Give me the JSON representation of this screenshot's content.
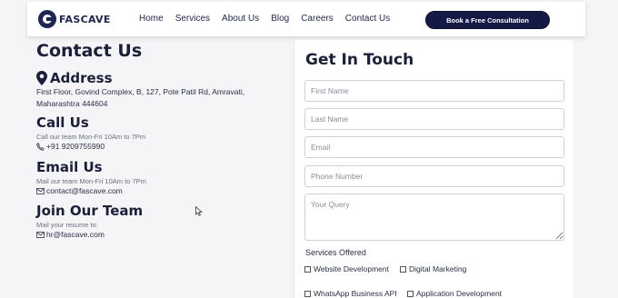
{
  "nav": {
    "logo_text": "FASCAVE",
    "links": [
      "Home",
      "Services",
      "About Us",
      "Blog",
      "Careers",
      "Contact Us"
    ],
    "cta_label": "Book a Free Consultation"
  },
  "contact": {
    "title": "Contact Us",
    "address": {
      "heading": "Address",
      "line1": "First Floor, Govind Complex, B, 127, Pote Patil Rd, Amravati,",
      "line2": "Maharashtra 444604"
    },
    "call": {
      "heading": "Call Us",
      "note": "Call our team Mon-Fri 10Am to 7Pm",
      "phone": "+91 9209755990"
    },
    "email": {
      "heading": "Email Us",
      "note": "Mail our team Mon-Fri 10Am to 7Pm",
      "address": "contact@fascave.com"
    },
    "join": {
      "heading": "Join Our Team",
      "note": "Mail your resume to:",
      "address": "hr@fascave.com"
    }
  },
  "form": {
    "title": "Get In Touch",
    "first_name_placeholder": "First Name",
    "last_name_placeholder": "Last Name",
    "email_placeholder": "Email",
    "phone_placeholder": "Phone Number",
    "query_placeholder": "Your Query",
    "services_label": "Services Offered",
    "services": [
      "Website Development",
      "Digital Marketing",
      "WhatsApp Business API",
      "Application Development"
    ]
  },
  "colors": {
    "brand_navy": "#1f2654",
    "cta_bg": "#141a45",
    "page_bg": "#f5f5f7"
  }
}
